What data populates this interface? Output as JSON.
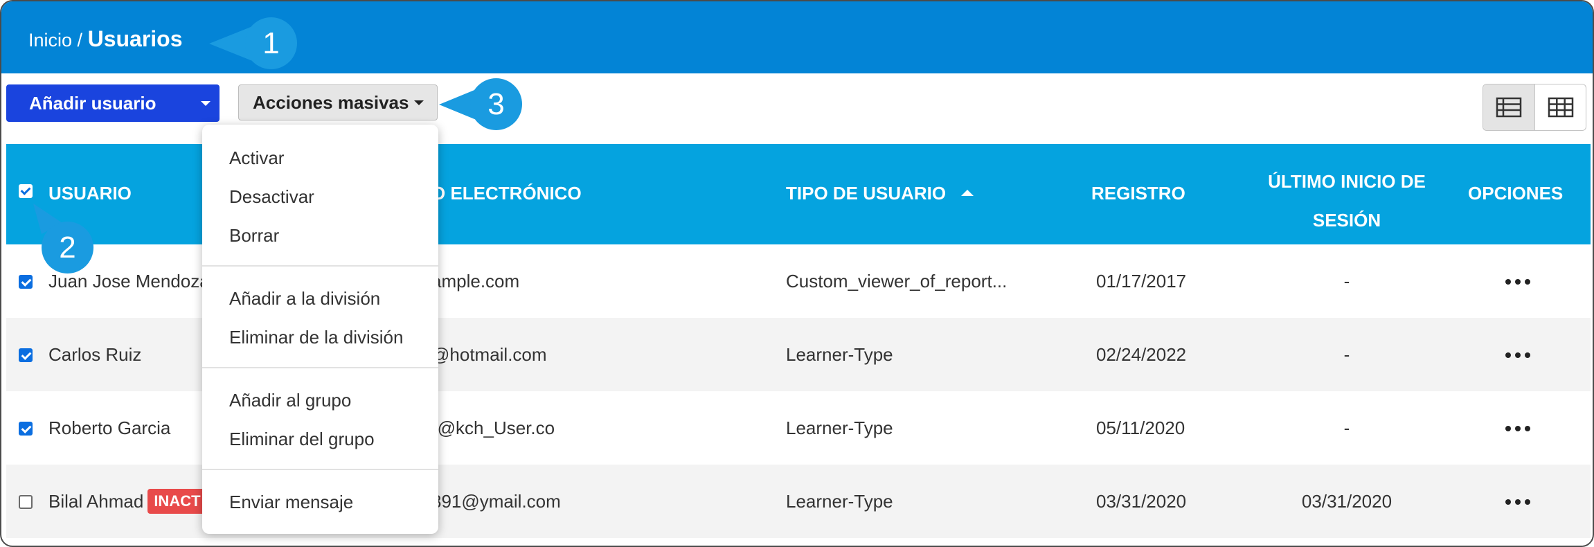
{
  "breadcrumb": {
    "home": "Inicio",
    "separator": "/",
    "current": "Usuarios"
  },
  "callouts": [
    "1",
    "2",
    "3"
  ],
  "toolbar": {
    "add_user_label": "Añadir usuario",
    "bulk_actions_label": "Acciones masivas",
    "view_list_icon": "list-view-icon",
    "view_grid_icon": "grid-view-icon"
  },
  "table": {
    "columns": {
      "user": "USUARIO",
      "email": "O ELECTRÓNICO",
      "type": "TIPO DE USUARIO",
      "registration": "REGISTRO",
      "last_login_1": "ÚLTIMO INICIO DE",
      "last_login_2": "SESIÓN",
      "options": "OPCIONES"
    },
    "rows": [
      {
        "checked": true,
        "name": "Juan Jose Mendoza",
        "badge": "",
        "email": "ample.com",
        "type": "Custom_viewer_of_report...",
        "registered": "01/17/2017",
        "last_login": "-"
      },
      {
        "checked": true,
        "name": "Carlos Ruiz",
        "badge": "",
        "email": "@hotmail.com",
        "type": "Learner-Type",
        "registered": "02/24/2022",
        "last_login": "-"
      },
      {
        "checked": true,
        "name": "Roberto Garcia",
        "badge": "",
        "email": "r@kch_User.co",
        "type": "Learner-Type",
        "registered": "05/11/2020",
        "last_login": "-"
      },
      {
        "checked": false,
        "name": "Bilal Ahmad",
        "badge": "INACT",
        "email": "891@ymail.com",
        "type": "Learner-Type",
        "registered": "03/31/2020",
        "last_login": "03/31/2020"
      }
    ]
  },
  "menu": {
    "items": [
      "Activar",
      "Desactivar",
      "Borrar",
      "Añadir a la división",
      "Eliminar de la división",
      "Añadir al grupo",
      "Eliminar del grupo",
      "Enviar mensaje"
    ]
  },
  "colors": {
    "header_bg": "#0384d6",
    "table_header_bg": "#05a3df",
    "primary_button": "#1a44de",
    "callout": "#1a9be0",
    "badge_inactive": "#e84a4a"
  }
}
